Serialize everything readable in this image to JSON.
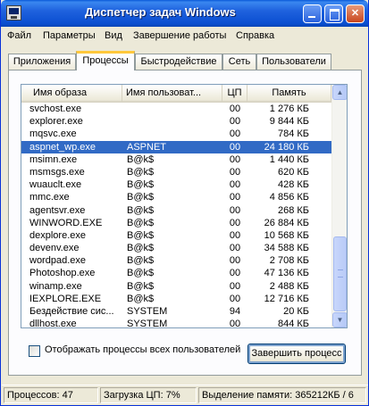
{
  "window": {
    "title": "Диспетчер задач Windows"
  },
  "menu": [
    "Файл",
    "Параметры",
    "Вид",
    "Завершение работы",
    "Справка"
  ],
  "tabs": [
    "Приложения",
    "Процессы",
    "Быстродействие",
    "Сеть",
    "Пользователи"
  ],
  "active_tab": "Процессы",
  "columns": [
    "Имя образа",
    "Имя пользоват...",
    "ЦП",
    "Память"
  ],
  "processes": [
    {
      "name": "svchost.exe",
      "user": "",
      "cpu": "00",
      "mem": "1 276 КБ"
    },
    {
      "name": "explorer.exe",
      "user": "",
      "cpu": "00",
      "mem": "9 844 КБ"
    },
    {
      "name": "mqsvc.exe",
      "user": "",
      "cpu": "00",
      "mem": "784 КБ"
    },
    {
      "name": "aspnet_wp.exe",
      "user": "ASPNET",
      "cpu": "00",
      "mem": "24 180 КБ",
      "selected": true
    },
    {
      "name": "msimn.exe",
      "user": "B@k$",
      "cpu": "00",
      "mem": "1 440 КБ"
    },
    {
      "name": "msmsgs.exe",
      "user": "B@k$",
      "cpu": "00",
      "mem": "620 КБ"
    },
    {
      "name": "wuauclt.exe",
      "user": "B@k$",
      "cpu": "00",
      "mem": "428 КБ"
    },
    {
      "name": "mmc.exe",
      "user": "B@k$",
      "cpu": "00",
      "mem": "4 856 КБ"
    },
    {
      "name": "agentsvr.exe",
      "user": "B@k$",
      "cpu": "00",
      "mem": "268 КБ"
    },
    {
      "name": "WINWORD.EXE",
      "user": "B@k$",
      "cpu": "00",
      "mem": "26 884 КБ"
    },
    {
      "name": "dexplore.exe",
      "user": "B@k$",
      "cpu": "00",
      "mem": "10 568 КБ"
    },
    {
      "name": "devenv.exe",
      "user": "B@k$",
      "cpu": "00",
      "mem": "34 588 КБ"
    },
    {
      "name": "wordpad.exe",
      "user": "B@k$",
      "cpu": "00",
      "mem": "2 708 КБ"
    },
    {
      "name": "Photoshop.exe",
      "user": "B@k$",
      "cpu": "00",
      "mem": "47 136 КБ"
    },
    {
      "name": "winamp.exe",
      "user": "B@k$",
      "cpu": "00",
      "mem": "2 488 КБ"
    },
    {
      "name": "IEXPLORE.EXE",
      "user": "B@k$",
      "cpu": "00",
      "mem": "12 716 КБ"
    },
    {
      "name": "Бездействие сис...",
      "user": "SYSTEM",
      "cpu": "94",
      "mem": "20 КБ"
    },
    {
      "name": "dllhost.exe",
      "user": "SYSTEM",
      "cpu": "00",
      "mem": "844 КБ"
    }
  ],
  "show_all_users_label": "Отображать процессы всех пользователей",
  "end_process_label": "Завершить процесс",
  "status": {
    "processes": "Процессов: 47",
    "cpu": "Загрузка ЦП: 7%",
    "memory": "Выделение памяти: 365212КБ / 6"
  }
}
